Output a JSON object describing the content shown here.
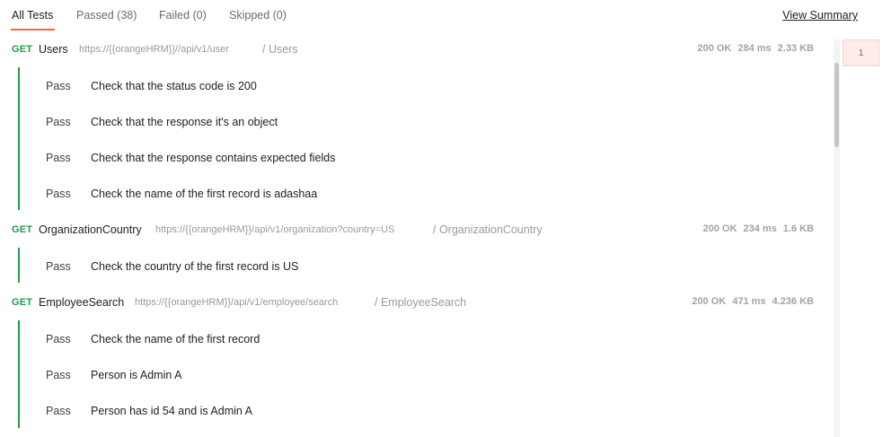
{
  "tabs": [
    {
      "label": "All Tests"
    },
    {
      "label": "Passed (38)"
    },
    {
      "label": "Failed (0)"
    },
    {
      "label": "Skipped (0)"
    }
  ],
  "view_summary": "View Summary",
  "requests": [
    {
      "method": "GET",
      "name": "Users",
      "url": "https://{{orangeHRM}}//api/v1/user",
      "path": "/ Users",
      "status": "200 OK",
      "time": "284 ms",
      "size": "2.33 KB",
      "tests": [
        {
          "status": "Pass",
          "name": "Check that the status code is 200"
        },
        {
          "status": "Pass",
          "name": "Check that the response it's an object"
        },
        {
          "status": "Pass",
          "name": "Check that the response contains expected fields"
        },
        {
          "status": "Pass",
          "name": "Check the name of the first record is adashaa"
        }
      ]
    },
    {
      "method": "GET",
      "name": "OrganizationCountry",
      "url": "https://{{orangeHRM}}/api/v1/organization?country=US",
      "path": "/ OrganizationCountry",
      "status": "200 OK",
      "time": "234 ms",
      "size": "1.6 KB",
      "tests": [
        {
          "status": "Pass",
          "name": "Check the country of the first record is US"
        }
      ]
    },
    {
      "method": "GET",
      "name": "EmployeeSearch",
      "url": "https://{{orangeHRM}}/api/v1/employee/search",
      "path": "/ EmployeeSearch",
      "status": "200 OK",
      "time": "471 ms",
      "size": "4.236 KB",
      "tests": [
        {
          "status": "Pass",
          "name": "Check the name of the first record"
        },
        {
          "status": "Pass",
          "name": "Person is Admin A"
        },
        {
          "status": "Pass",
          "name": "Person has id 54 and is Admin A"
        }
      ]
    }
  ],
  "minimap": {
    "label": "1"
  },
  "colors": {
    "accent": "#f26b3a",
    "method_get": "#1e9c4a",
    "pass_bar": "#1e9c4a"
  }
}
